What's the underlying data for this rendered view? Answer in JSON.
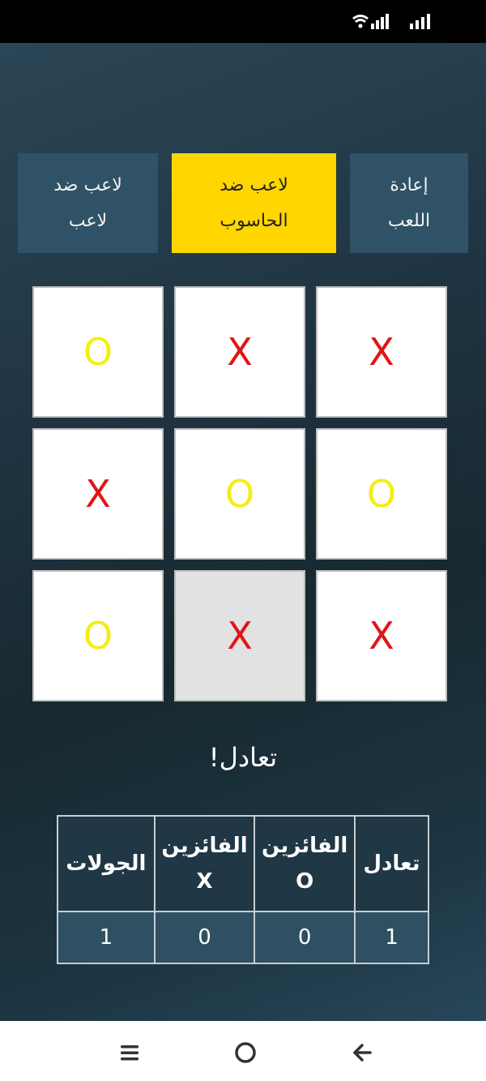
{
  "status_bar": {
    "icons": [
      "wifi-icon",
      "signal-icon",
      "signal-icon"
    ]
  },
  "mode_buttons": {
    "pvp": {
      "line1": "لاعب ضد",
      "line2": "لاعب"
    },
    "pvc": {
      "line1": "لاعب ضد",
      "line2": "الحاسوب",
      "active": true
    },
    "reset": {
      "line1": "إعادة",
      "line2": "اللعب"
    }
  },
  "board": {
    "cells": [
      "O",
      "X",
      "X",
      "X",
      "O",
      "O",
      "O",
      "X",
      "X"
    ],
    "highlighted_cell": 7
  },
  "result": "!تعادل",
  "scoreboard": {
    "headers": {
      "rounds": "الجولات",
      "winners_x_label": "الفائزين",
      "winners_x_symbol": "X",
      "winners_o_label": "الفائزين",
      "winners_o_symbol": "O",
      "draws": "تعادل"
    },
    "values": {
      "rounds": "1",
      "winners_x": "0",
      "winners_o": "0",
      "draws": "1"
    }
  },
  "colors": {
    "accent": "#ffd600",
    "x_mark": "#e01515",
    "o_mark": "#f4ee12",
    "button": "#2f5266"
  },
  "nav_bar": {
    "icons": [
      "menu-icon",
      "home-icon",
      "back-icon"
    ]
  }
}
